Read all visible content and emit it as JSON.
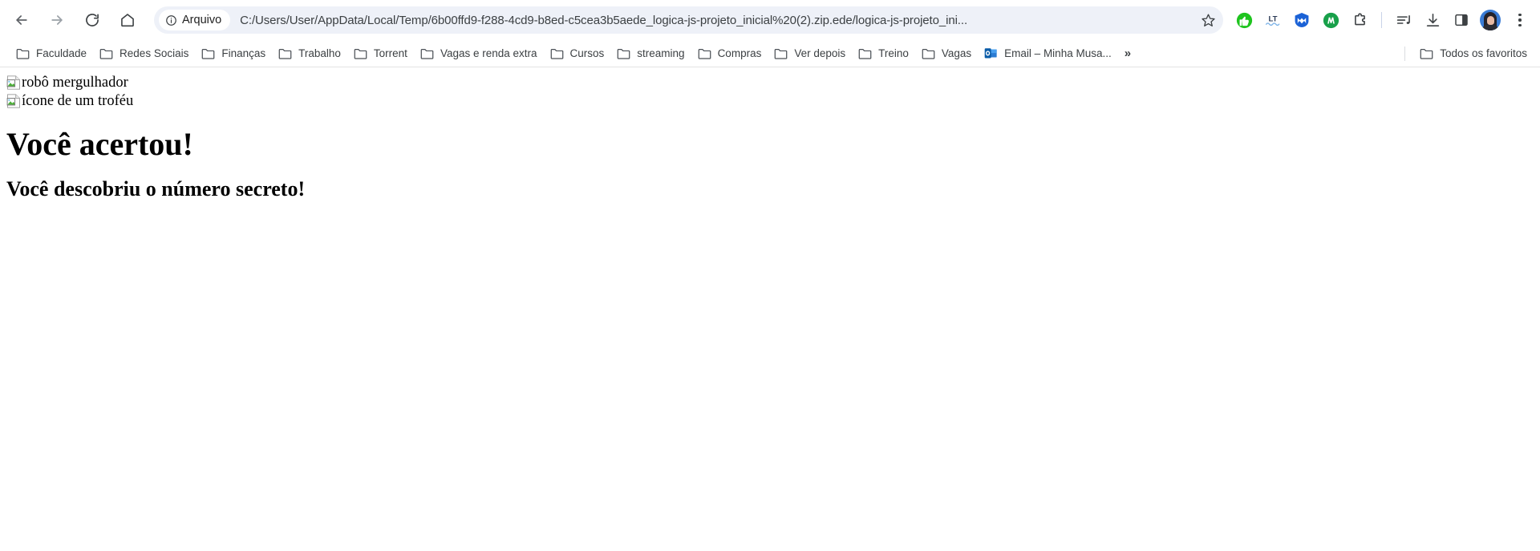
{
  "browser": {
    "nav": {
      "back_label": "Back",
      "forward_label": "Forward",
      "reload_label": "Reload",
      "home_label": "Home"
    },
    "omnibox": {
      "security_chip_label": "Arquivo",
      "security_chip_icon": "info-circle-icon",
      "url": "C:/Users/User/AppData/Local/Temp/6b00ffd9-f288-4cd9-b8ed-c5cea3b5aede_logica-js-projeto_inicial%20(2).zip.ede/logica-js-projeto_ini...",
      "bookmark_star_label": "Bookmark this tab"
    },
    "extensions": [
      {
        "name": "adblock-thumbs-up-extension-icon",
        "color": "#1ec41e",
        "glyph": "thumb"
      },
      {
        "name": "languagetool-extension-icon",
        "color": "#2b5797",
        "glyph": "lt"
      },
      {
        "name": "malwarebytes-extension-icon",
        "color": "#1b62d6",
        "glyph": "m-shield"
      },
      {
        "name": "mailtrack-extension-icon",
        "color": "#18a04a",
        "glyph": "circle-m"
      },
      {
        "name": "extensions-puzzle-icon",
        "color": "#3c4043",
        "glyph": "puzzle"
      }
    ],
    "actions": [
      {
        "name": "media-playlist-icon",
        "label": "Media controls"
      },
      {
        "name": "downloads-icon",
        "label": "Downloads"
      },
      {
        "name": "side-panel-icon",
        "label": "Side panel"
      }
    ],
    "profile": {
      "name": "profile-avatar",
      "label": "Profile"
    },
    "menu": {
      "name": "chrome-menu-icon",
      "label": "Customize and control Google Chrome"
    }
  },
  "bookmarks": {
    "items": [
      {
        "label": "Faculdade",
        "icon": "folder-icon"
      },
      {
        "label": "Redes Sociais",
        "icon": "folder-icon"
      },
      {
        "label": "Finanças",
        "icon": "folder-icon"
      },
      {
        "label": "Trabalho",
        "icon": "folder-icon"
      },
      {
        "label": "Torrent",
        "icon": "folder-icon"
      },
      {
        "label": "Vagas e renda extra",
        "icon": "folder-icon"
      },
      {
        "label": "Cursos",
        "icon": "folder-icon"
      },
      {
        "label": "streaming",
        "icon": "folder-icon"
      },
      {
        "label": "Compras",
        "icon": "folder-icon"
      },
      {
        "label": "Ver depois",
        "icon": "folder-icon"
      },
      {
        "label": "Treino",
        "icon": "folder-icon"
      },
      {
        "label": "Vagas",
        "icon": "folder-icon"
      },
      {
        "label": "Email – Minha Musa...",
        "icon": "outlook-icon"
      }
    ],
    "overflow_label": "»",
    "all_bookmarks": {
      "label": "Todos os favoritos",
      "icon": "folder-icon"
    }
  },
  "content": {
    "images": [
      {
        "alt": "robô mergulhador",
        "state": "broken"
      },
      {
        "alt": "ícone de um troféu",
        "state": "broken"
      }
    ],
    "heading": "Você acertou!",
    "subheading": "Você descobriu o número secreto!"
  }
}
